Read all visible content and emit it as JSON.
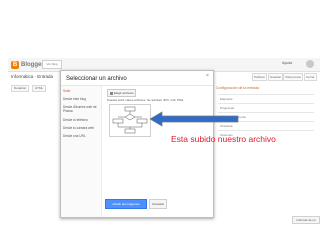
{
  "blogger": {
    "logo_text": "Blogger",
    "top_search": "Ver blog",
    "top_right": "Ayuda",
    "page_title": "Informática · Entrada",
    "toolbar": [
      "Redactar",
      "HTML"
    ],
    "right_buttons": [
      "Publicar",
      "Guardar",
      "Vista previa",
      "Cerrar"
    ],
    "right_panel_title": "Configuración de la entrada",
    "right_items": [
      "Etiquetas",
      "Programar",
      "Enlace permanente",
      "Ubicación",
      "Opciones"
    ],
    "bottom_button": "Informar de un problema"
  },
  "dialog": {
    "title": "Seleccionar un archivo",
    "close": "×",
    "nav_items": [
      "Subir",
      "Desde este blog",
      "Desde Álbumes web de Picasa",
      "Desde tu teléfono",
      "Desde tu cámara web",
      "Desde una URL"
    ],
    "upload_button": "Elegir archivos",
    "upload_hint": "Puedes subir varios archivos. Se admiten JPG, GIF, PNG.",
    "add_button": "Añadir las imágenes seleccionadas",
    "cancel_button": "Cancelar"
  },
  "annotation": {
    "text": "Esta subido nuestro archivo",
    "color": "#e0162b"
  },
  "colors": {
    "accent": "#f57d00",
    "primary_button": "#4d90fe",
    "arrow_blue": "#2e6cc7",
    "arrow_outline": "#7a7a7a"
  }
}
